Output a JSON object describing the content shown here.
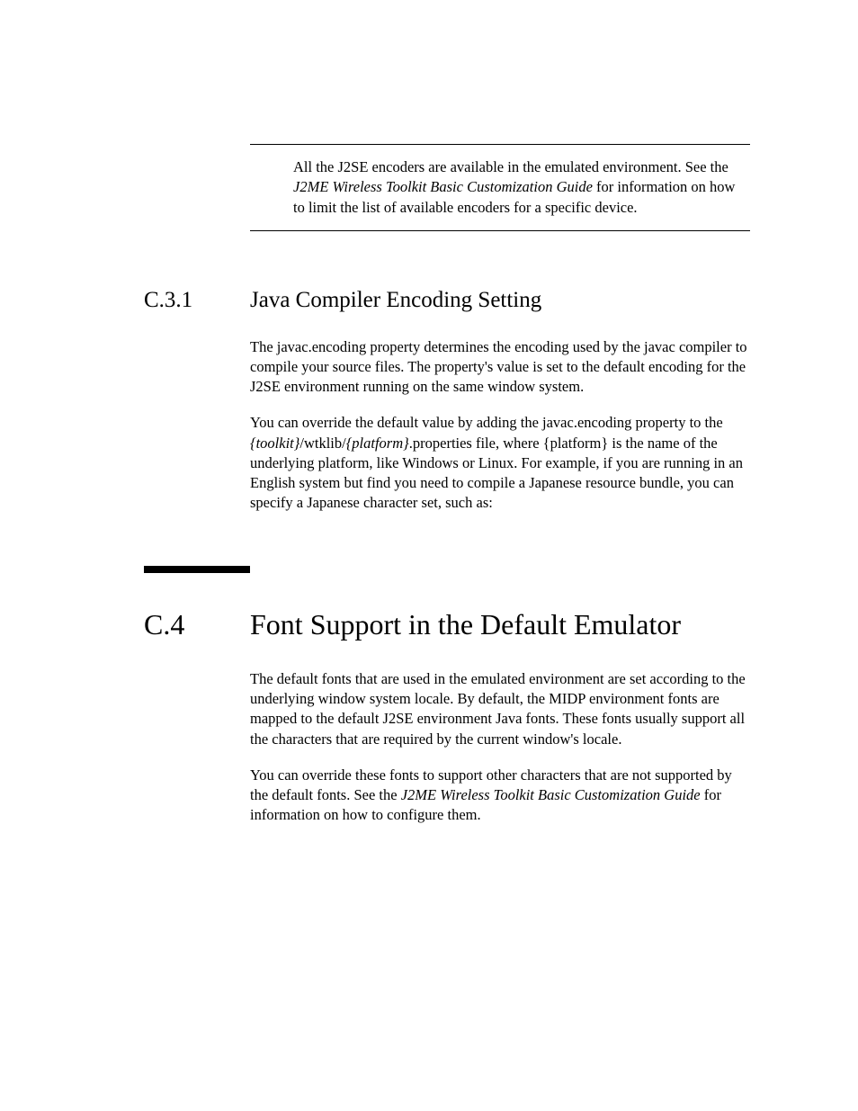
{
  "note": {
    "prefix": "All the J2SE encoders are available in the emulated environment. See the ",
    "italic": "J2ME Wireless Toolkit Basic Customization Guide",
    "suffix": " for information on how to limit the list of available encoders for a specific device."
  },
  "section_c31": {
    "number": "C.3.1",
    "title": "Java Compiler Encoding Setting",
    "p1": "The javac.encoding property determines the encoding used by the javac compiler to compile your source files. The property's value is set to the default encoding for the J2SE environment running on the same window system.",
    "p2_a": "You can override the default value by adding the javac.encoding property to the ",
    "p2_toolkit": "{toolkit}",
    "p2_b": "/wtklib/",
    "p2_platform": "{platform}",
    "p2_c": ".properties file, where {platform} is the name of the underlying platform, like Windows or Linux. For example, if you are running in an English system but find you need to compile a Japanese resource bundle, you can specify a Japanese character set, such as:"
  },
  "section_c4": {
    "number": "C.4",
    "title": "Font Support in the Default Emulator",
    "p1": "The default fonts that are used in the emulated environment are set according to the underlying window system locale. By default, the MIDP environment fonts are mapped to the default J2SE environment Java fonts. These fonts usually support all the characters that are required by the current window's locale.",
    "p2_a": "You can override these fonts to support other characters that are not supported by the default fonts. See the ",
    "p2_italic": "J2ME Wireless Toolkit Basic Customization Guide",
    "p2_b": " for information on how to configure them."
  }
}
